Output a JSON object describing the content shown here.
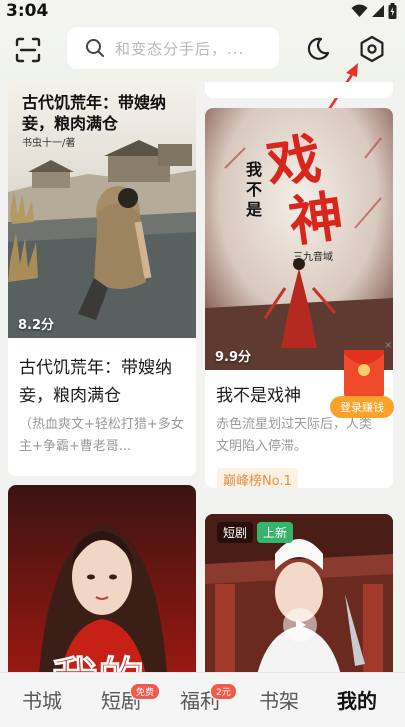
{
  "status_bar": {
    "time": "3:04"
  },
  "header": {
    "search_placeholder": "和变态分手后，..."
  },
  "books": [
    {
      "cover_title": "古代饥荒年：带嫂纳妾，粮肉满仓",
      "cover_author": "书虫十一/著",
      "rating": "8.2分",
      "title": "古代饥荒年：带嫂纳妾，粮肉满仓",
      "desc": "（热血爽文+轻松打猎+多女主+争霸+曹老哥..."
    },
    {
      "cover_title_chars": [
        "我",
        "不",
        "是"
      ],
      "cover_title_big": [
        "戏",
        "神"
      ],
      "cover_author": "三九音域",
      "rating": "9.9分",
      "title": "我不是戏神",
      "desc": "赤色流星划过天际后，人类文明陷入停滞。",
      "tag": "巅峰榜No.1"
    },
    {
      "cover_title": "我的"
    },
    {
      "badge_drama": "短剧",
      "badge_new": "上新"
    }
  ],
  "float_gift": {
    "label": "登录赚钱"
  },
  "bottom_nav": [
    {
      "label": "书城"
    },
    {
      "label": "短剧",
      "badge": "免费"
    },
    {
      "label": "福利",
      "badge": "2元"
    },
    {
      "label": "书架"
    },
    {
      "label": "我的"
    }
  ],
  "colors": {
    "accent_red": "#e8322b",
    "tag_orange": "#e09245",
    "new_badge_green": "#35b56a"
  }
}
